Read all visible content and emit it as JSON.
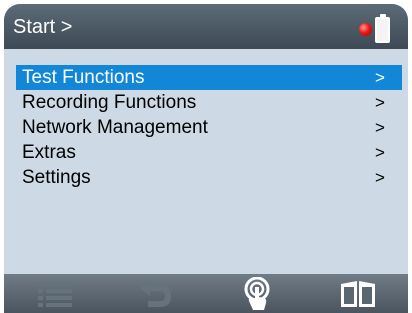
{
  "header": {
    "title": "Start >",
    "status_color": "#f01616"
  },
  "menu": {
    "items": [
      {
        "label": "Test Functions",
        "arrow": ">",
        "selected": true
      },
      {
        "label": "Recording Functions",
        "arrow": ">",
        "selected": false
      },
      {
        "label": "Network Management",
        "arrow": ">",
        "selected": false
      },
      {
        "label": "Extras",
        "arrow": ">",
        "selected": false
      },
      {
        "label": "Settings",
        "arrow": ">",
        "selected": false
      }
    ],
    "selected_color": "#1287d8"
  },
  "footer": {
    "buttons": [
      {
        "icon": "list-icon",
        "enabled": false
      },
      {
        "icon": "back-arrow-icon",
        "enabled": false
      },
      {
        "icon": "touch-icon",
        "enabled": true
      },
      {
        "icon": "book-icon",
        "enabled": true
      }
    ]
  }
}
